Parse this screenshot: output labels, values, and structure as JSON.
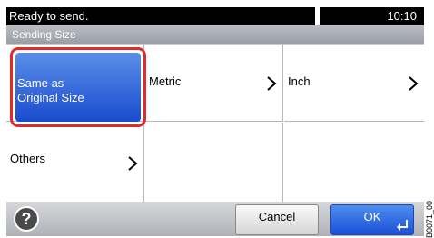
{
  "status": {
    "message": "Ready to send.",
    "time": "10:10"
  },
  "title": "Sending Size",
  "options": {
    "same_as_original": "Same as\nOriginal Size",
    "metric": "Metric",
    "inch": "Inch",
    "others": "Others"
  },
  "footer": {
    "help": "?",
    "cancel": "Cancel",
    "ok": "OK"
  },
  "side_code": "B0071_00",
  "colors": {
    "selected_fill": "#1a4bd0",
    "selection_outline": "#e02b2b",
    "ok_fill": "#1a4fd6"
  }
}
